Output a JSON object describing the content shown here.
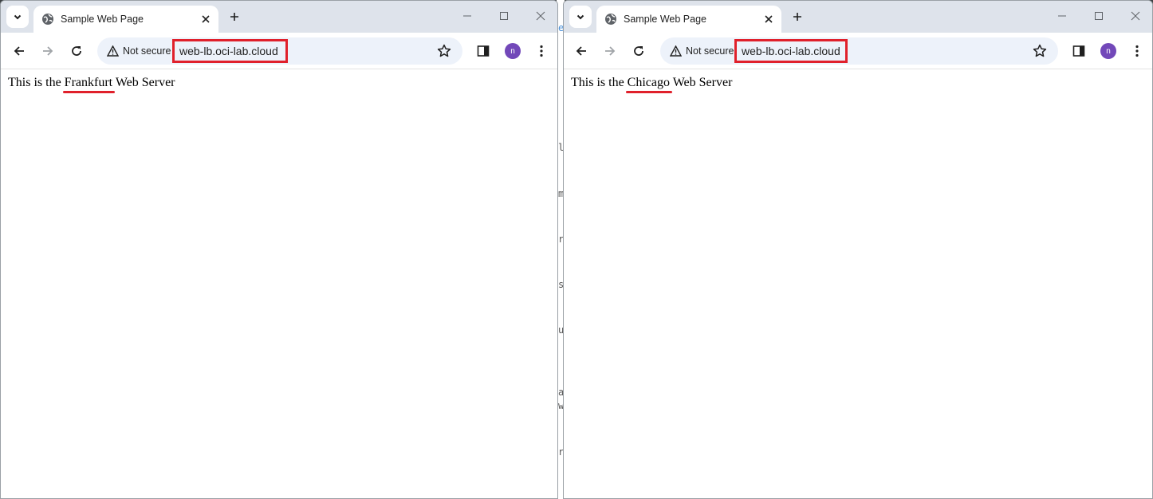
{
  "background_code_glyphs": [
    "e",
    "l",
    "m",
    "r",
    "s",
    "u",
    "a",
    "w",
    "r"
  ],
  "colors": {
    "highlight": "#e0202b",
    "tabbar": "#dee3eb",
    "omnibox": "#edf2fa",
    "avatar": "#7248b9"
  },
  "windows": [
    {
      "tab_title": "Sample Web Page",
      "security_label": "Not secure",
      "url": "web-lb.oci-lab.cloud",
      "profile_initial": "n",
      "page": {
        "prefix": "This is the ",
        "city": "Frankfurt",
        "suffix": " Web Server"
      }
    },
    {
      "tab_title": "Sample Web Page",
      "security_label": "Not secure",
      "url": "web-lb.oci-lab.cloud",
      "profile_initial": "n",
      "page": {
        "prefix": "This is the ",
        "city": "Chicago",
        "suffix": " Web Server"
      }
    }
  ]
}
